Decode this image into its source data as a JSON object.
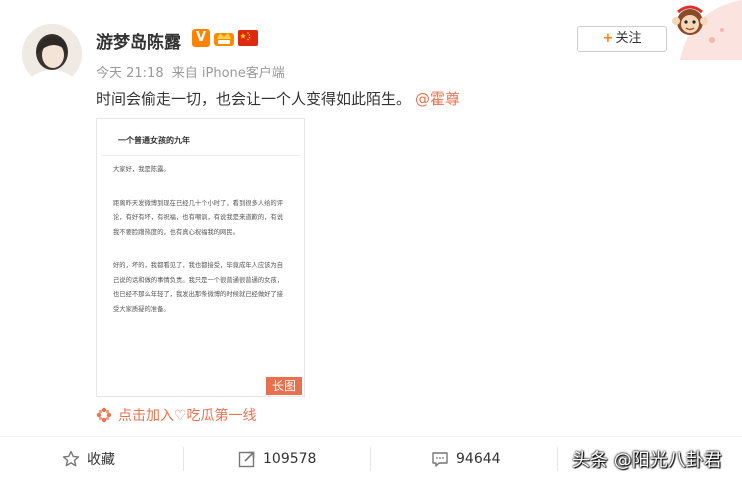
{
  "post": {
    "username": "游梦岛陈露",
    "time": "今天 21:18",
    "source": "来自 iPhone客户端",
    "text": "时间会偷走一切，也会让一个人变得如此陌生。",
    "mention": "@霍尊",
    "follow_label": "关注",
    "follow_plus": "+",
    "badge_v": "V"
  },
  "article": {
    "title": "一个普通女孩的九年",
    "paragraphs": [
      "大家好，我是陈露。",
      "距离昨天发微博到现在已经几十个小时了，看到很多人给的评论，有好有坏，有祝福，也有嘲讽，有说我是来道歉的，有说我不要脸蹭热度的，也有真心祝福我的网民。",
      "好的，坏的，我都看见了，我也都接受，毕竟成年人应该为自己说的话和做的事情负责。我只是一个很普通很普通的女孩，也已经不那么年轻了，我发出那条微博的时候就已经做好了接受大家质疑的准备。"
    ],
    "long_image_tag": "长图"
  },
  "topic": {
    "label": "点击加入♡吃瓜第一线"
  },
  "actions": {
    "favorite_label": "收藏",
    "repost_count": "109578",
    "comment_count": "94644"
  },
  "watermark": "头条 @阳光八卦君",
  "colors": {
    "orange": "#ff8200",
    "link": "#eb7350",
    "tag_bg": "#e8704e"
  }
}
